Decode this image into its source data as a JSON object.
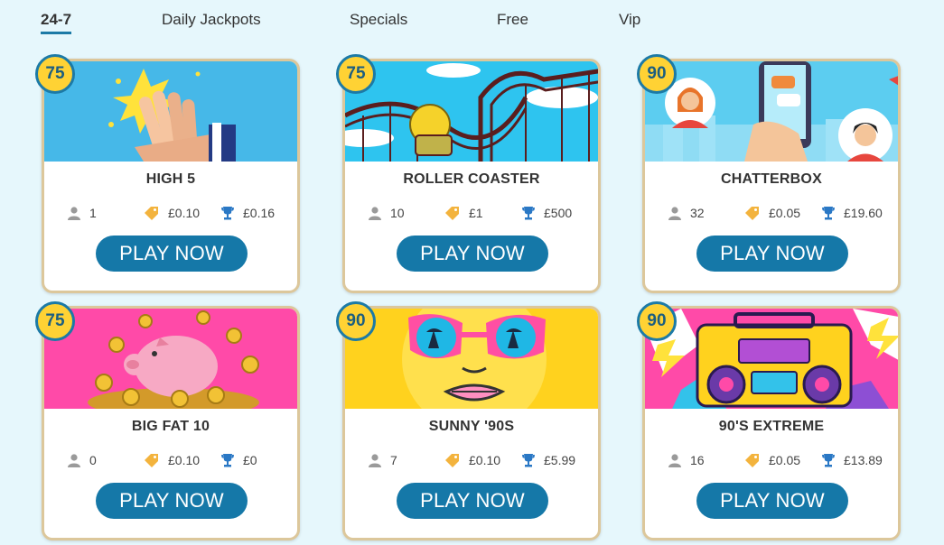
{
  "tabs": [
    {
      "label": "24-7",
      "active": true
    },
    {
      "label": "Daily Jackpots",
      "active": false
    },
    {
      "label": "Specials",
      "active": false
    },
    {
      "label": "Free",
      "active": false
    },
    {
      "label": "Vip",
      "active": false
    }
  ],
  "colors": {
    "background": "#e6f7fc",
    "button": "#1578a8",
    "badge": "#ffd234",
    "badge_border": "#1c7aa6",
    "card_border": "#dcc79b"
  },
  "icons": {
    "players": "person-icon",
    "price": "tag-icon",
    "prize": "trophy-icon"
  },
  "cards": [
    {
      "badge": "75",
      "title": "HIGH 5",
      "players": "1",
      "price": "£0.10",
      "prize": "£0.16",
      "button": "PLAY NOW"
    },
    {
      "badge": "75",
      "title": "ROLLER COASTER",
      "players": "10",
      "price": "£1",
      "prize": "£500",
      "button": "PLAY NOW"
    },
    {
      "badge": "90",
      "title": "CHATTERBOX",
      "players": "32",
      "price": "£0.05",
      "prize": "£19.60",
      "button": "PLAY NOW"
    },
    {
      "badge": "75",
      "title": "BIG FAT 10",
      "players": "0",
      "price": "£0.10",
      "prize": "£0",
      "button": "PLAY NOW"
    },
    {
      "badge": "90",
      "title": "SUNNY '90S",
      "players": "7",
      "price": "£0.10",
      "prize": "£5.99",
      "button": "PLAY NOW"
    },
    {
      "badge": "90",
      "title": "90'S EXTREME",
      "players": "16",
      "price": "£0.05",
      "prize": "£13.89",
      "button": "PLAY NOW"
    }
  ]
}
